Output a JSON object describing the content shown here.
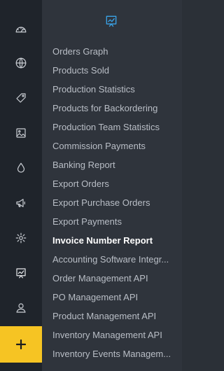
{
  "rail": {
    "icons": [
      "dashboard-gauge-icon",
      "globe-icon",
      "tag-icon",
      "image-icon",
      "drop-icon",
      "megaphone-icon",
      "gear-icon",
      "reports-icon",
      "user-icon"
    ],
    "active_icon": "reports-icon",
    "add_label": "+"
  },
  "panel": {
    "header_icon": "reports-icon",
    "accent_color": "#3aa3e8",
    "items": [
      {
        "label": "Orders Graph"
      },
      {
        "label": "Products Sold"
      },
      {
        "label": "Production Statistics"
      },
      {
        "label": "Products for Backordering"
      },
      {
        "label": "Production Team Statistics"
      },
      {
        "label": "Commission Payments"
      },
      {
        "label": "Banking Report"
      },
      {
        "label": "Export Orders"
      },
      {
        "label": "Export Purchase Orders"
      },
      {
        "label": "Export Payments"
      },
      {
        "label": "Invoice Number Report",
        "active": true
      },
      {
        "label": "Accounting Software Integr..."
      },
      {
        "label": "Order Management API"
      },
      {
        "label": "PO Management API"
      },
      {
        "label": "Product Management API"
      },
      {
        "label": "Inventory Management API"
      },
      {
        "label": "Inventory Events Managem..."
      }
    ]
  },
  "colors": {
    "rail_bg": "#1f242b",
    "panel_bg": "#2f343c",
    "add_button_bg": "#f6c423"
  }
}
